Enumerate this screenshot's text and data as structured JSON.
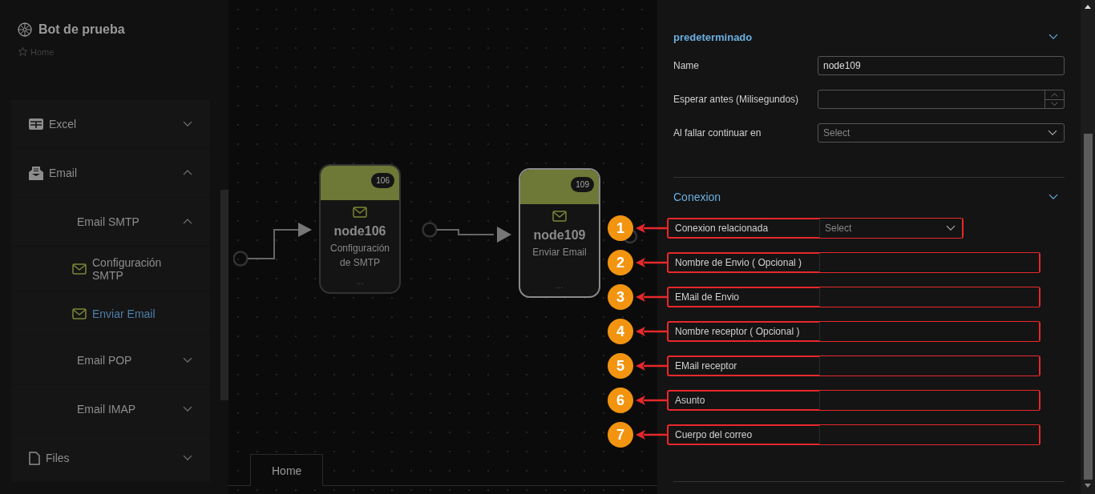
{
  "app": {
    "title": "Bot de prueba",
    "breadcrumb": "Home"
  },
  "sidebar": {
    "items": [
      {
        "label": "Excel",
        "kind": "sheet",
        "expanded": false
      },
      {
        "label": "Email",
        "kind": "mailbox",
        "expanded": true,
        "children": [
          {
            "label": "Email SMTP",
            "kind": "group",
            "expanded": true,
            "children": [
              {
                "label": "Configuración SMTP",
                "kind": "action",
                "selected": false
              },
              {
                "label": "Enviar Email",
                "kind": "action",
                "selected": true
              }
            ]
          },
          {
            "label": "Email POP",
            "kind": "group",
            "expanded": false
          },
          {
            "label": "Email IMAP",
            "kind": "group",
            "expanded": false
          }
        ]
      },
      {
        "label": "Files",
        "kind": "file",
        "expanded": false
      }
    ]
  },
  "canvas": {
    "nodes": [
      {
        "badge": "106",
        "title": "node106",
        "subtitle": "Configuración de SMTP",
        "more": "...",
        "selected": false
      },
      {
        "badge": "109",
        "title": "node109",
        "subtitle": "Enviar Email",
        "more": "...",
        "selected": true
      }
    ],
    "tabs": [
      {
        "label": "Home",
        "selected": true
      }
    ]
  },
  "panel": {
    "sections": [
      {
        "title": "predeterminado",
        "expanded": true,
        "fields": [
          {
            "kind": "text",
            "label": "Name",
            "value": "node109",
            "highlighted": false
          },
          {
            "kind": "number",
            "label": "Esperar antes (Milisegundos)",
            "highlighted": false
          },
          {
            "kind": "select",
            "label": "Al fallar continuar en",
            "placeholder": "Select",
            "highlighted": false
          }
        ]
      },
      {
        "title": "Conexion",
        "expanded": true,
        "fields": [
          {
            "kind": "select",
            "label": "Conexion relacionada",
            "placeholder": "Select",
            "highlighted": true,
            "callout": "1"
          },
          {
            "kind": "text",
            "label": "Nombre de Envio ( Opcional )",
            "highlighted": true,
            "callout": "2"
          },
          {
            "kind": "text",
            "label": "EMail de Envio",
            "highlighted": true,
            "callout": "3"
          },
          {
            "kind": "text",
            "label": "Nombre receptor ( Opcional )",
            "highlighted": true,
            "callout": "4"
          },
          {
            "kind": "text",
            "label": "EMail receptor",
            "highlighted": true,
            "callout": "5"
          },
          {
            "kind": "text",
            "label": "Asunto",
            "highlighted": true,
            "callout": "6"
          },
          {
            "kind": "text",
            "label": "Cuerpo del correo",
            "highlighted": true,
            "callout": "7"
          }
        ]
      }
    ]
  }
}
